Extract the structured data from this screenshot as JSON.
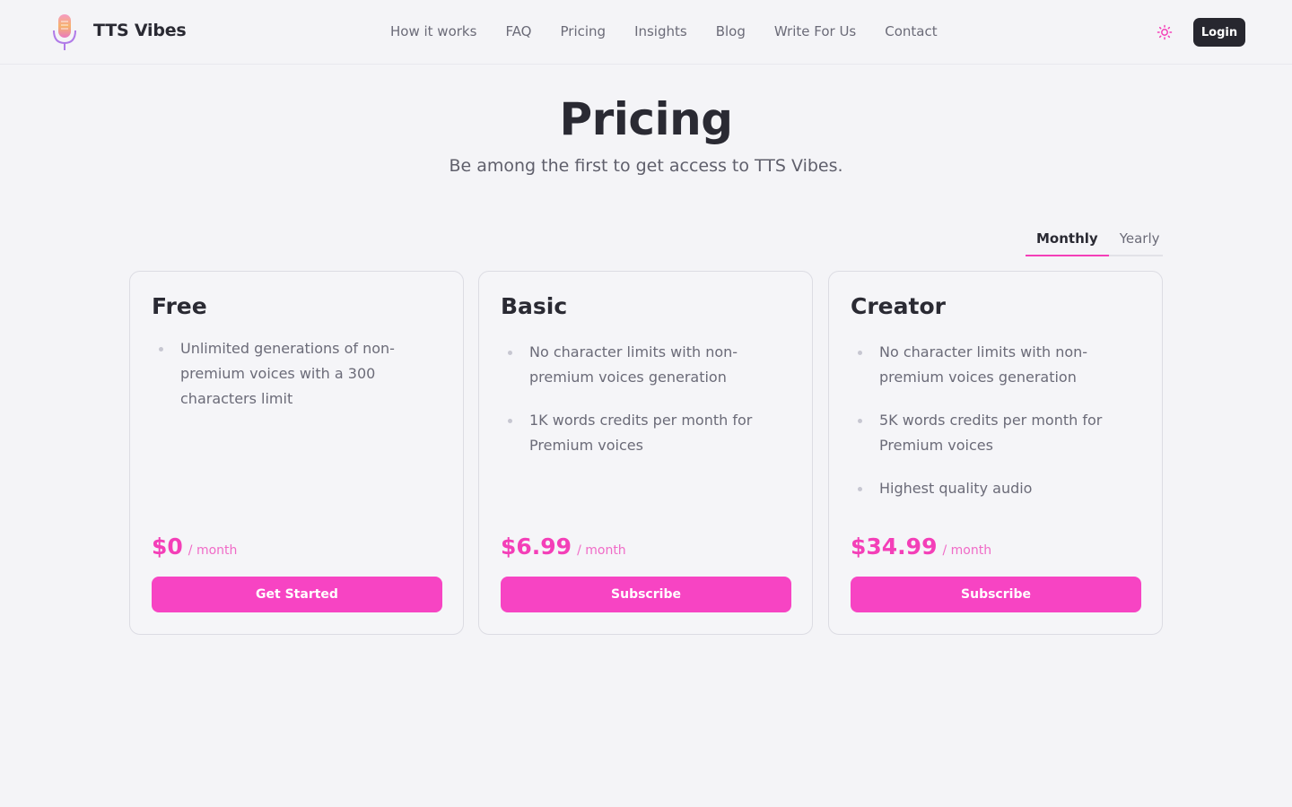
{
  "header": {
    "brand": "TTS Vibes",
    "nav": [
      "How it works",
      "FAQ",
      "Pricing",
      "Insights",
      "Blog",
      "Write For Us",
      "Contact"
    ],
    "theme_icon": "sun-icon",
    "login_label": "Login"
  },
  "hero": {
    "title": "Pricing",
    "subtitle": "Be among the first to get access to TTS Vibes."
  },
  "billing_tabs": {
    "monthly": "Monthly",
    "yearly": "Yearly",
    "active": "Monthly"
  },
  "plans": [
    {
      "name": "Free",
      "features": [
        "Unlimited generations of non-premium voices with a 300 characters limit"
      ],
      "price": "$0",
      "period": "/ month",
      "cta": "Get Started"
    },
    {
      "name": "Basic",
      "features": [
        "No character limits with non-premium voices generation",
        "1K words credits per month for Premium voices"
      ],
      "price": "$6.99",
      "period": "/ month",
      "cta": "Subscribe"
    },
    {
      "name": "Creator",
      "features": [
        "No character limits with non-premium voices generation",
        "5K words credits per month for Premium voices",
        "Highest quality audio"
      ],
      "price": "$34.99",
      "period": "/ month",
      "cta": "Subscribe"
    }
  ],
  "colors": {
    "accent": "#f744c3",
    "dark": "#27272f",
    "background": "#f4f4f7"
  }
}
